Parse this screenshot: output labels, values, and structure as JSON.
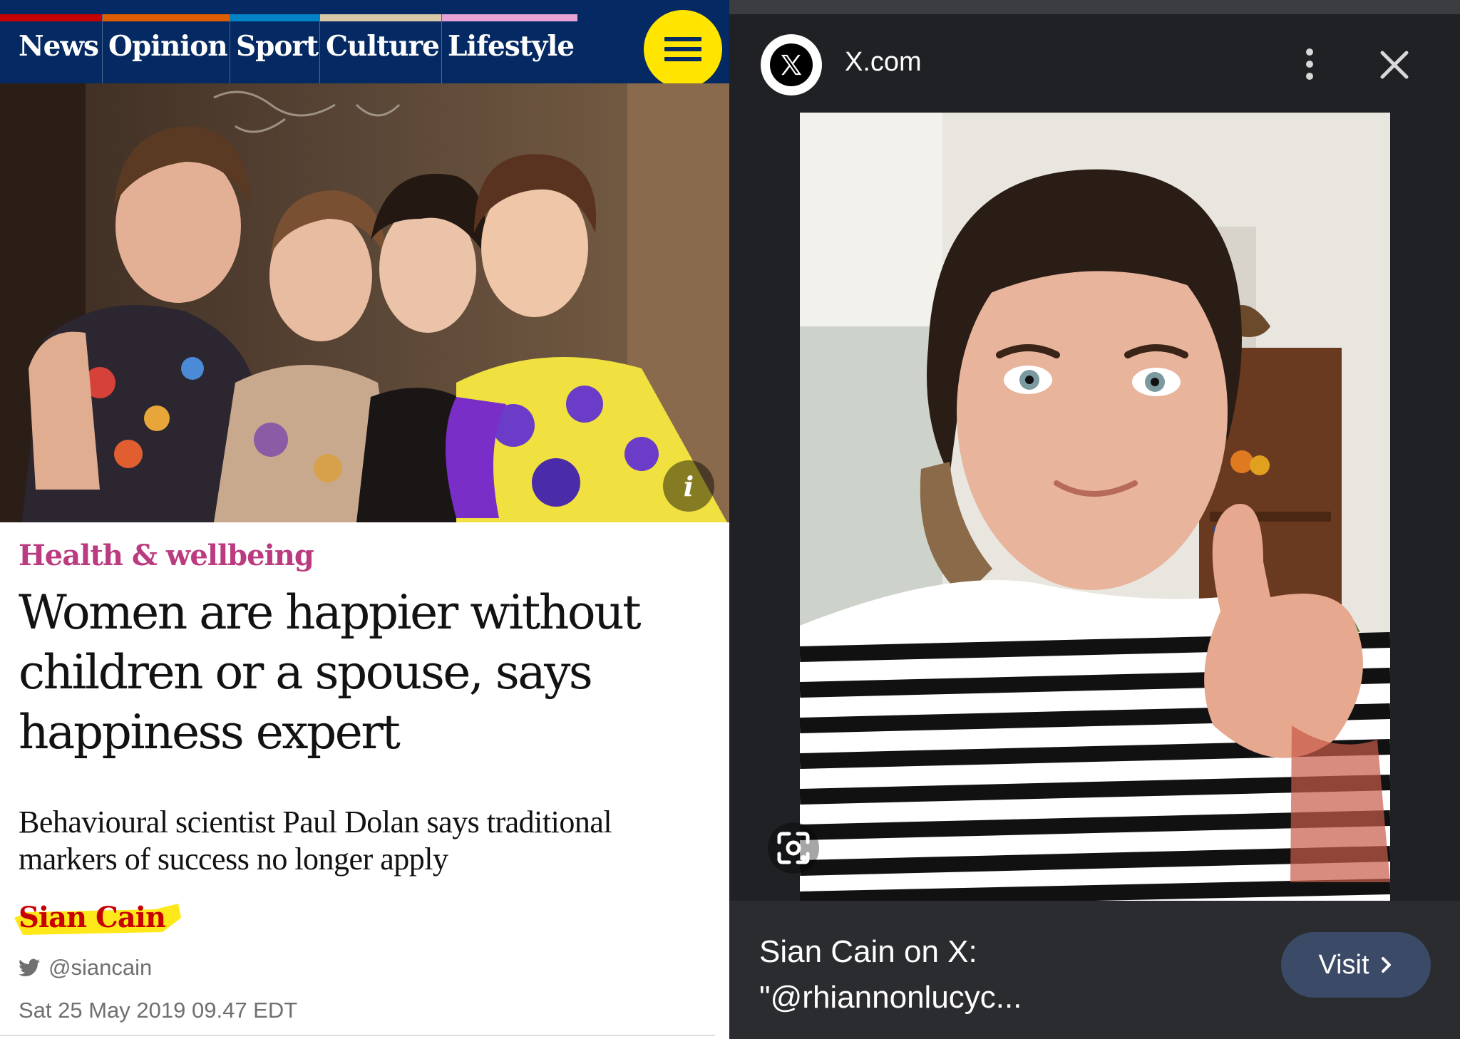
{
  "left_article": {
    "nav": {
      "items": [
        {
          "label": "News",
          "color": "#c70000"
        },
        {
          "label": "Opinion",
          "color": "#e05e00"
        },
        {
          "label": "Sport",
          "color": "#0084c6"
        },
        {
          "label": "Culture",
          "color": "#a1845c"
        },
        {
          "label": "Lifestyle",
          "color": "#bb3b80"
        }
      ],
      "background": "#052962",
      "menu_icon": "hamburger-menu-icon",
      "menu_color": "#ffe500"
    },
    "hero_info_label": "i",
    "kicker": "Health & wellbeing",
    "headline": "Women are happier without children or a spouse, says happiness expert",
    "standfirst": "Behavioural scientist Paul Dolan says traditional markers of success no longer apply",
    "byline": "Sian Cain",
    "twitter_handle": "@siancain",
    "dateline": "Sat 25 May 2019 09.47 EDT",
    "colors": {
      "kicker": "#bb3b80",
      "byline": "#c70000",
      "highlight": "#ffe500"
    }
  },
  "right_preview": {
    "site_name": "X.com",
    "logo_icon": "x-logo-icon",
    "title": "Sian Cain on X: \"@rhiannonlucyc...",
    "visit_label": "Visit",
    "visit_icon": "chevron-right-icon",
    "menu_icon": "more-vert-icon",
    "close_icon": "close-icon",
    "lens_icon": "google-lens-icon"
  }
}
